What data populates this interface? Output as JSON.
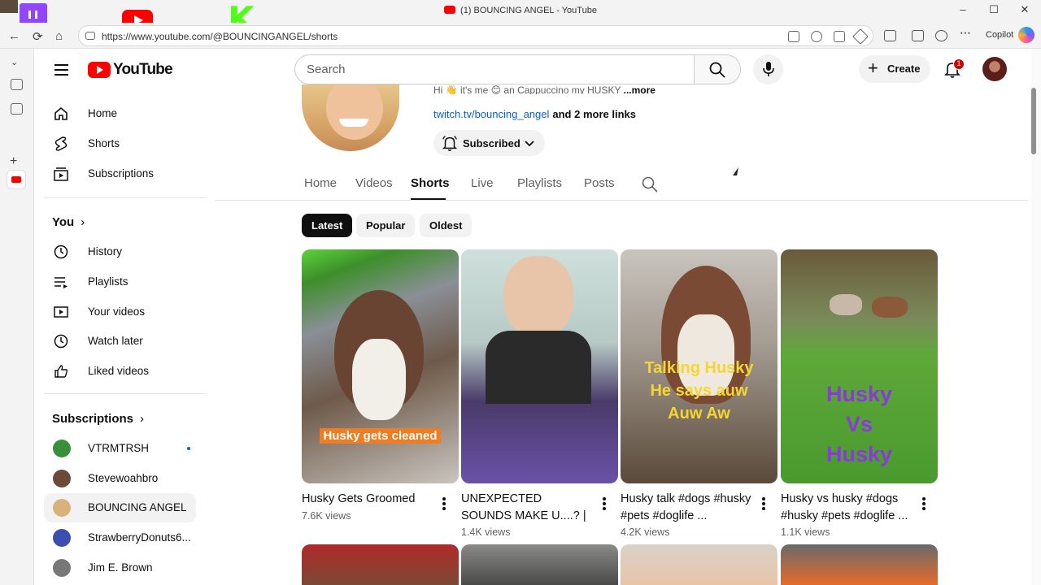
{
  "browser": {
    "window_title": "(1) BOUNCING ANGEL - YouTube",
    "url": "https://www.youtube.com/@BOUNCINGANGEL/shorts",
    "copilot_label": "Copilot",
    "win_buttons": [
      "–",
      "☐",
      "✕"
    ],
    "nav_glyphs": [
      "←",
      "⟳",
      "⌂"
    ]
  },
  "youtube": {
    "wordmark": "YouTube",
    "search_placeholder": "Search",
    "create_label": "Create",
    "notification_count": "1"
  },
  "sidebar": {
    "main": [
      {
        "label": "Home",
        "icon": "home-icon"
      },
      {
        "label": "Shorts",
        "icon": "shorts-icon"
      },
      {
        "label": "Subscriptions",
        "icon": "subscriptions-icon"
      }
    ],
    "you_title": "You",
    "you_items": [
      {
        "label": "History",
        "icon": "history-icon"
      },
      {
        "label": "Playlists",
        "icon": "playlists-icon"
      },
      {
        "label": "Your videos",
        "icon": "your-videos-icon"
      },
      {
        "label": "Watch later",
        "icon": "watch-later-icon"
      },
      {
        "label": "Liked videos",
        "icon": "liked-videos-icon"
      }
    ],
    "subs_title": "Subscriptions",
    "subscriptions": [
      {
        "label": "VTRMTRSH",
        "live": true,
        "color": "#3a8f3a"
      },
      {
        "label": "Stevewoahbro",
        "live": false,
        "color": "#6b4a3a"
      },
      {
        "label": "BOUNCING ANGEL",
        "live": false,
        "active": true,
        "color": "#d9b27a"
      },
      {
        "label": "StrawberryDonuts6...",
        "live": false,
        "color": "#3a4fb0"
      },
      {
        "label": "Jim E. Brown",
        "live": false,
        "color": "#777777"
      }
    ]
  },
  "channel": {
    "description": "Hi 👋 it's me 😊 an Cappuccino my HUSKY",
    "more_label": "...more",
    "link": "twitch.tv/bouncing_angel",
    "more_links": "and 2 more links",
    "subscribed_label": "Subscribed",
    "tabs": [
      "Home",
      "Videos",
      "Shorts",
      "Live",
      "Playlists",
      "Posts"
    ],
    "active_tab": "Shorts"
  },
  "filters": [
    "Latest",
    "Popular",
    "Oldest"
  ],
  "shorts": [
    {
      "title": "Husky Gets Groomed",
      "views": "7.6K views",
      "overlay": "Husky gets cleaned"
    },
    {
      "title": "UNEXPECTED SOUNDS MAKE U....? | ...",
      "views": "1.4K views",
      "overlay": ""
    },
    {
      "title": "Husky talk  #dogs #husky #pets #doglife ...",
      "views": "4.2K views",
      "overlay": "Talking Husky He says auw Auw Aw"
    },
    {
      "title": "Husky vs husky  #dogs #husky #pets #doglife ...",
      "views": "1.1K views",
      "overlay": "Husky Vs Husky"
    }
  ]
}
